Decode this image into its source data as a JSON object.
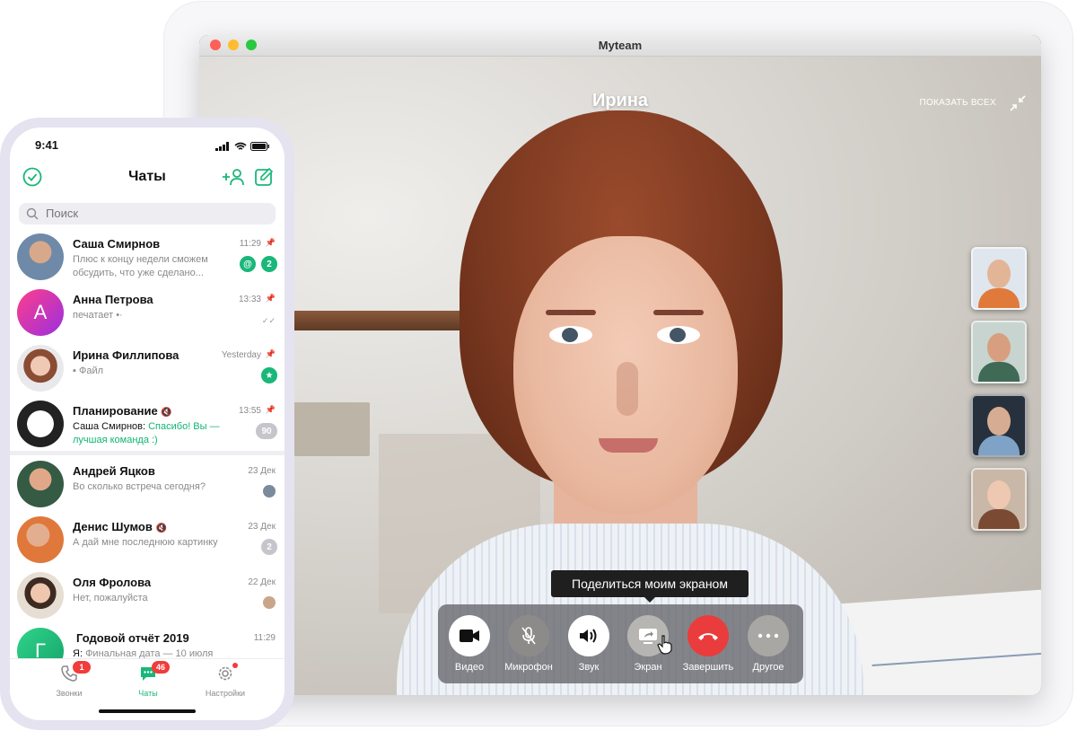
{
  "window": {
    "title": "Myteam"
  },
  "call": {
    "caller_name": "Ирина",
    "show_all_label": "ПОКАЗАТЬ ВСЕХ",
    "tooltip": "Поделиться моим экраном",
    "controls": [
      {
        "label": "Видео",
        "icon": "video-camera-icon"
      },
      {
        "label": "Микрофон",
        "icon": "microphone-muted-icon"
      },
      {
        "label": "Звук",
        "icon": "speaker-icon"
      },
      {
        "label": "Экран",
        "icon": "screen-share-icon"
      },
      {
        "label": "Завершить",
        "icon": "hang-up-icon"
      },
      {
        "label": "Другое",
        "icon": "more-dots-icon"
      }
    ]
  },
  "phone": {
    "status_time": "9:41",
    "header_title": "Чаты",
    "search_placeholder": "Поиск",
    "chats": [
      {
        "name": "Саша Смирнов",
        "message": "Плюс к концу недели сможем обсудить, что уже сделано...",
        "time": "11:29",
        "mention": "@",
        "unread": "2"
      },
      {
        "name": "Анна Петрова",
        "avatar_letter": "А",
        "message": "печатает",
        "time": "13:33"
      },
      {
        "name": "Ирина Филлипова",
        "message": "Файл",
        "time": "Yesterday",
        "star": "★"
      },
      {
        "name": "Планирование",
        "sender": "Саша Смирнов:",
        "message": "Спасибо! Вы — лучшая команда :)",
        "time": "13:55",
        "unread": "90"
      },
      {
        "name": "Андрей Яцков",
        "message": "Во сколько встреча сегодня?",
        "time": "23 Дек"
      },
      {
        "name": "Денис Шумов",
        "message": "А дай мне последнюю картинку",
        "time": "23 Дек",
        "unread": "2"
      },
      {
        "name": "Оля Фролова",
        "message": "Нет, пожалуйста",
        "time": "22 Дек"
      },
      {
        "name": "Годовой отчёт 2019",
        "avatar_letter": "Г",
        "sender": "Я:",
        "message": "Финальная дата — 10 июля",
        "time": "11:29"
      }
    ],
    "tabs": [
      {
        "label": "Звонки",
        "badge": "1"
      },
      {
        "label": "Чаты",
        "badge": "46"
      },
      {
        "label": "Настройки"
      }
    ]
  },
  "colors": {
    "accent": "#19b77a",
    "hangup": "#ea3c3c",
    "badge_red": "#f23b3b"
  }
}
